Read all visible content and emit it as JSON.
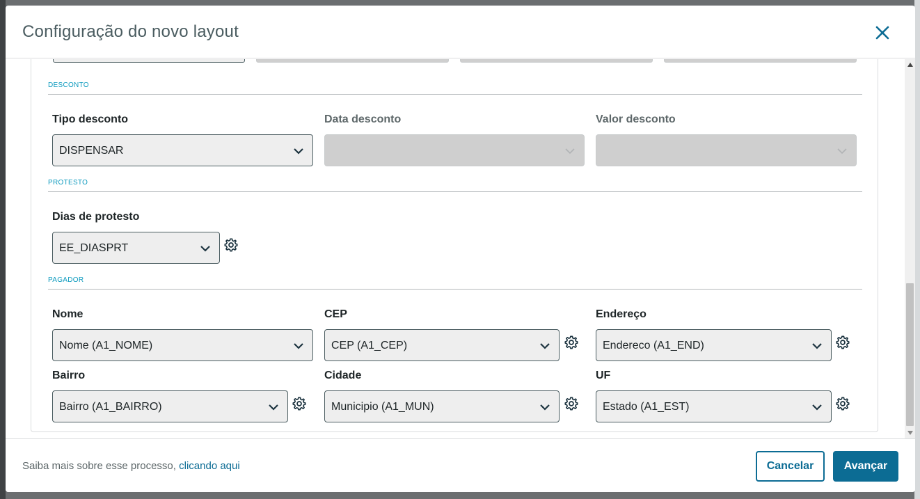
{
  "modal": {
    "title": "Configuração do novo layout"
  },
  "sections": {
    "desconto": {
      "title": "DESCONTO",
      "tipo_label": "Tipo desconto",
      "tipo_value": "DISPENSAR",
      "data_label": "Data desconto",
      "data_value": "",
      "valor_label": "Valor desconto",
      "valor_value": ""
    },
    "protesto": {
      "title": "PROTESTO",
      "dias_label": "Dias de protesto",
      "dias_value": "EE_DIASPRT"
    },
    "pagador": {
      "title": "PAGADOR",
      "nome_label": "Nome",
      "nome_value": "Nome (A1_NOME)",
      "cep_label": "CEP",
      "cep_value": "CEP (A1_CEP)",
      "endereco_label": "Endereço",
      "endereco_value": "Endereco (A1_END)",
      "bairro_label": "Bairro",
      "bairro_value": "Bairro (A1_BAIRRO)",
      "cidade_label": "Cidade",
      "cidade_value": "Municipio (A1_MUN)",
      "uf_label": "UF",
      "uf_value": "Estado (A1_EST)"
    }
  },
  "footer": {
    "help_text": "Saiba mais sobre esse processo, ",
    "help_link": "clicando aqui",
    "cancel_label": "Cancelar",
    "next_label": "Avançar"
  },
  "icons": {
    "close": "close-icon",
    "chevron": "chevron-down-icon",
    "gear": "gear-icon"
  },
  "colors": {
    "primary": "#0c6c94",
    "section_title": "#0c9abe",
    "disabled_field": "#cfcfcf"
  }
}
